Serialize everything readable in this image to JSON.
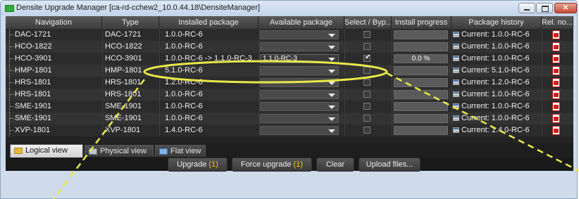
{
  "window": {
    "title": "Densite Upgrade Manager [ca-rd-cchew2_10.0.44.18\\DensiteManager]"
  },
  "columns": [
    {
      "label": "Navigation"
    },
    {
      "label": "Type"
    },
    {
      "label": "Installed package"
    },
    {
      "label": "Available package"
    },
    {
      "label": "Select / Byp..."
    },
    {
      "label": "Install progress"
    },
    {
      "label": "Package history"
    },
    {
      "label": "Rel. no..."
    }
  ],
  "rows": [
    {
      "navigation": "DAC-1721",
      "type": "DAC-1721",
      "installed": "1.0.0-RC-6",
      "available": "",
      "selected": false,
      "progress": "",
      "history": "Current: 1.0.0-RC-6"
    },
    {
      "navigation": "HCO-1822",
      "type": "HCO-1822",
      "installed": "1.0.0-RC-6",
      "available": "",
      "selected": false,
      "progress": "",
      "history": "Current: 1.0.0-RC-6"
    },
    {
      "navigation": "HCO-3901",
      "type": "HCO-3901",
      "installed": "1.0.0-RC-6 -> 1.1.0-RC-3",
      "available": "1.1.0-RC-3",
      "selected": true,
      "progress": "0.0 %",
      "history": "Current: 1.0.0-RC-6"
    },
    {
      "navigation": "HMP-1801",
      "type": "HMP-1801",
      "installed": "5.1.0-RC-6",
      "available": "",
      "selected": false,
      "progress": "",
      "history": "Current: 5.1.0-RC-6"
    },
    {
      "navigation": "HRS-1801",
      "type": "HRS-1801",
      "installed": "1.2.0-RC-6",
      "available": "",
      "selected": false,
      "progress": "",
      "history": "Current: 1.2.0-RC-6"
    },
    {
      "navigation": "HRS-1801",
      "type": "HRS-1801",
      "installed": "1.0.0-RC-6",
      "available": "",
      "selected": false,
      "progress": "",
      "history": "Current: 1.0.0-RC-6"
    },
    {
      "navigation": "SME-1901",
      "type": "SME-1901",
      "installed": "1.0.0-RC-6",
      "available": "",
      "selected": false,
      "progress": "",
      "history": "Current: 1.0.0-RC-6"
    },
    {
      "navigation": "SME-1901",
      "type": "SME-1901",
      "installed": "1.0.0-RC-6",
      "available": "",
      "selected": false,
      "progress": "",
      "history": "Current: 1.0.0-RC-6"
    },
    {
      "navigation": "XVP-1801",
      "type": "XVP-1801",
      "installed": "1.4.0-RC-6",
      "available": "",
      "selected": false,
      "progress": "",
      "history": "Current: 1.4.0-RC-6"
    }
  ],
  "tabs": [
    {
      "label": "Logical view",
      "icon": "folder-icon",
      "active": true
    },
    {
      "label": "Physical view",
      "icon": "computer-icon",
      "active": false
    },
    {
      "label": "Flat view",
      "icon": "list-icon",
      "active": false
    }
  ],
  "actions": {
    "upgrade_label": "Upgrade",
    "upgrade_count": "(1)",
    "force_label": "Force upgrade",
    "force_count": "(1)",
    "clear_label": "Clear",
    "upload_label": "Upload files..."
  },
  "colors": {
    "highlight_annotation": "#e8e84a",
    "accent_count": "#f2c400",
    "pdf_red": "#d51c1c"
  }
}
